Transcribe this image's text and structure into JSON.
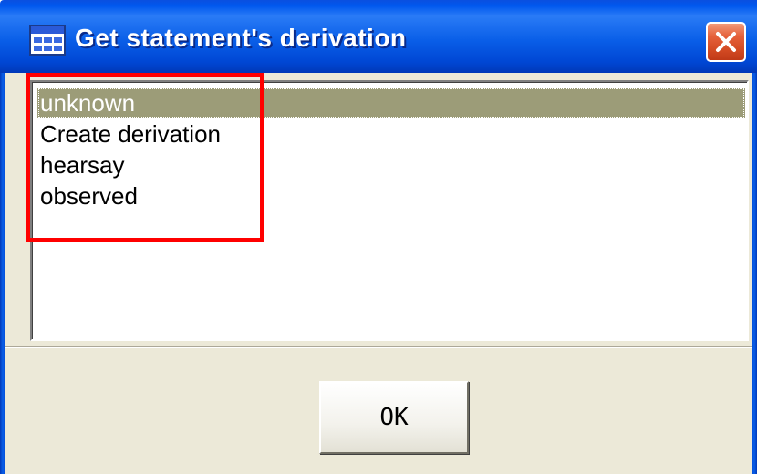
{
  "window": {
    "title": "Get statement's derivation",
    "icon": "application-window-icon",
    "close_icon": "close-icon"
  },
  "listbox": {
    "items": [
      {
        "label": "unknown",
        "selected": true
      },
      {
        "label": "Create derivation",
        "selected": false
      },
      {
        "label": "hearsay",
        "selected": false
      },
      {
        "label": "observed",
        "selected": false
      }
    ]
  },
  "buttons": {
    "ok_label": "OK"
  },
  "colors": {
    "titlebar": "#0058ee",
    "close_button": "#e5603a",
    "selection": "#9c9c78",
    "dialog_background": "#ece9d8",
    "annotation": "#ff0000"
  }
}
